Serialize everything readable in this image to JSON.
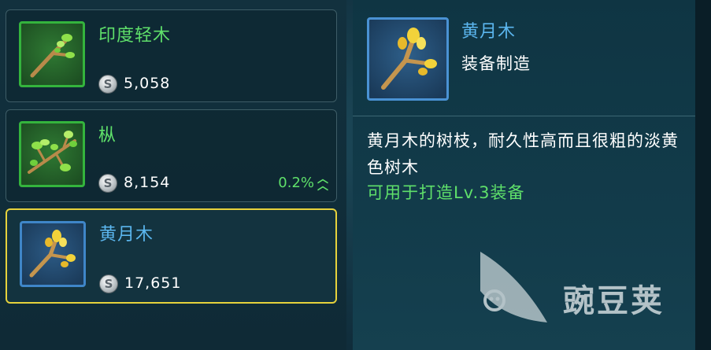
{
  "items": [
    {
      "name": "印度轻木",
      "price": "5,058",
      "coin_symbol": "S",
      "rarity": "green",
      "trend": ""
    },
    {
      "name": "枞",
      "price": "8,154",
      "coin_symbol": "S",
      "rarity": "green",
      "trend": "0.2%"
    },
    {
      "name": "黄月木",
      "price": "17,651",
      "coin_symbol": "S",
      "rarity": "blue",
      "trend": ""
    }
  ],
  "detail": {
    "name": "黄月木",
    "type": "装备制造",
    "description": "黄月木的树枝，耐久性高而且很粗的淡黄色树木",
    "usage": "可用于打造Lv.3装备"
  },
  "watermark": {
    "text": "豌豆荚"
  },
  "colors": {
    "green_rarity": "#34b43d",
    "blue_rarity": "#3f86c8",
    "selected_border": "#e6d23c",
    "green_text": "#5fe06a",
    "blue_text": "#5bb6ee"
  },
  "icons": {
    "item_0": "green-branch-icon",
    "item_1": "leafy-branch-icon",
    "item_2": "yellow-branch-icon",
    "trend": "double-chevron-up-icon",
    "coin": "silver-coin-icon"
  }
}
